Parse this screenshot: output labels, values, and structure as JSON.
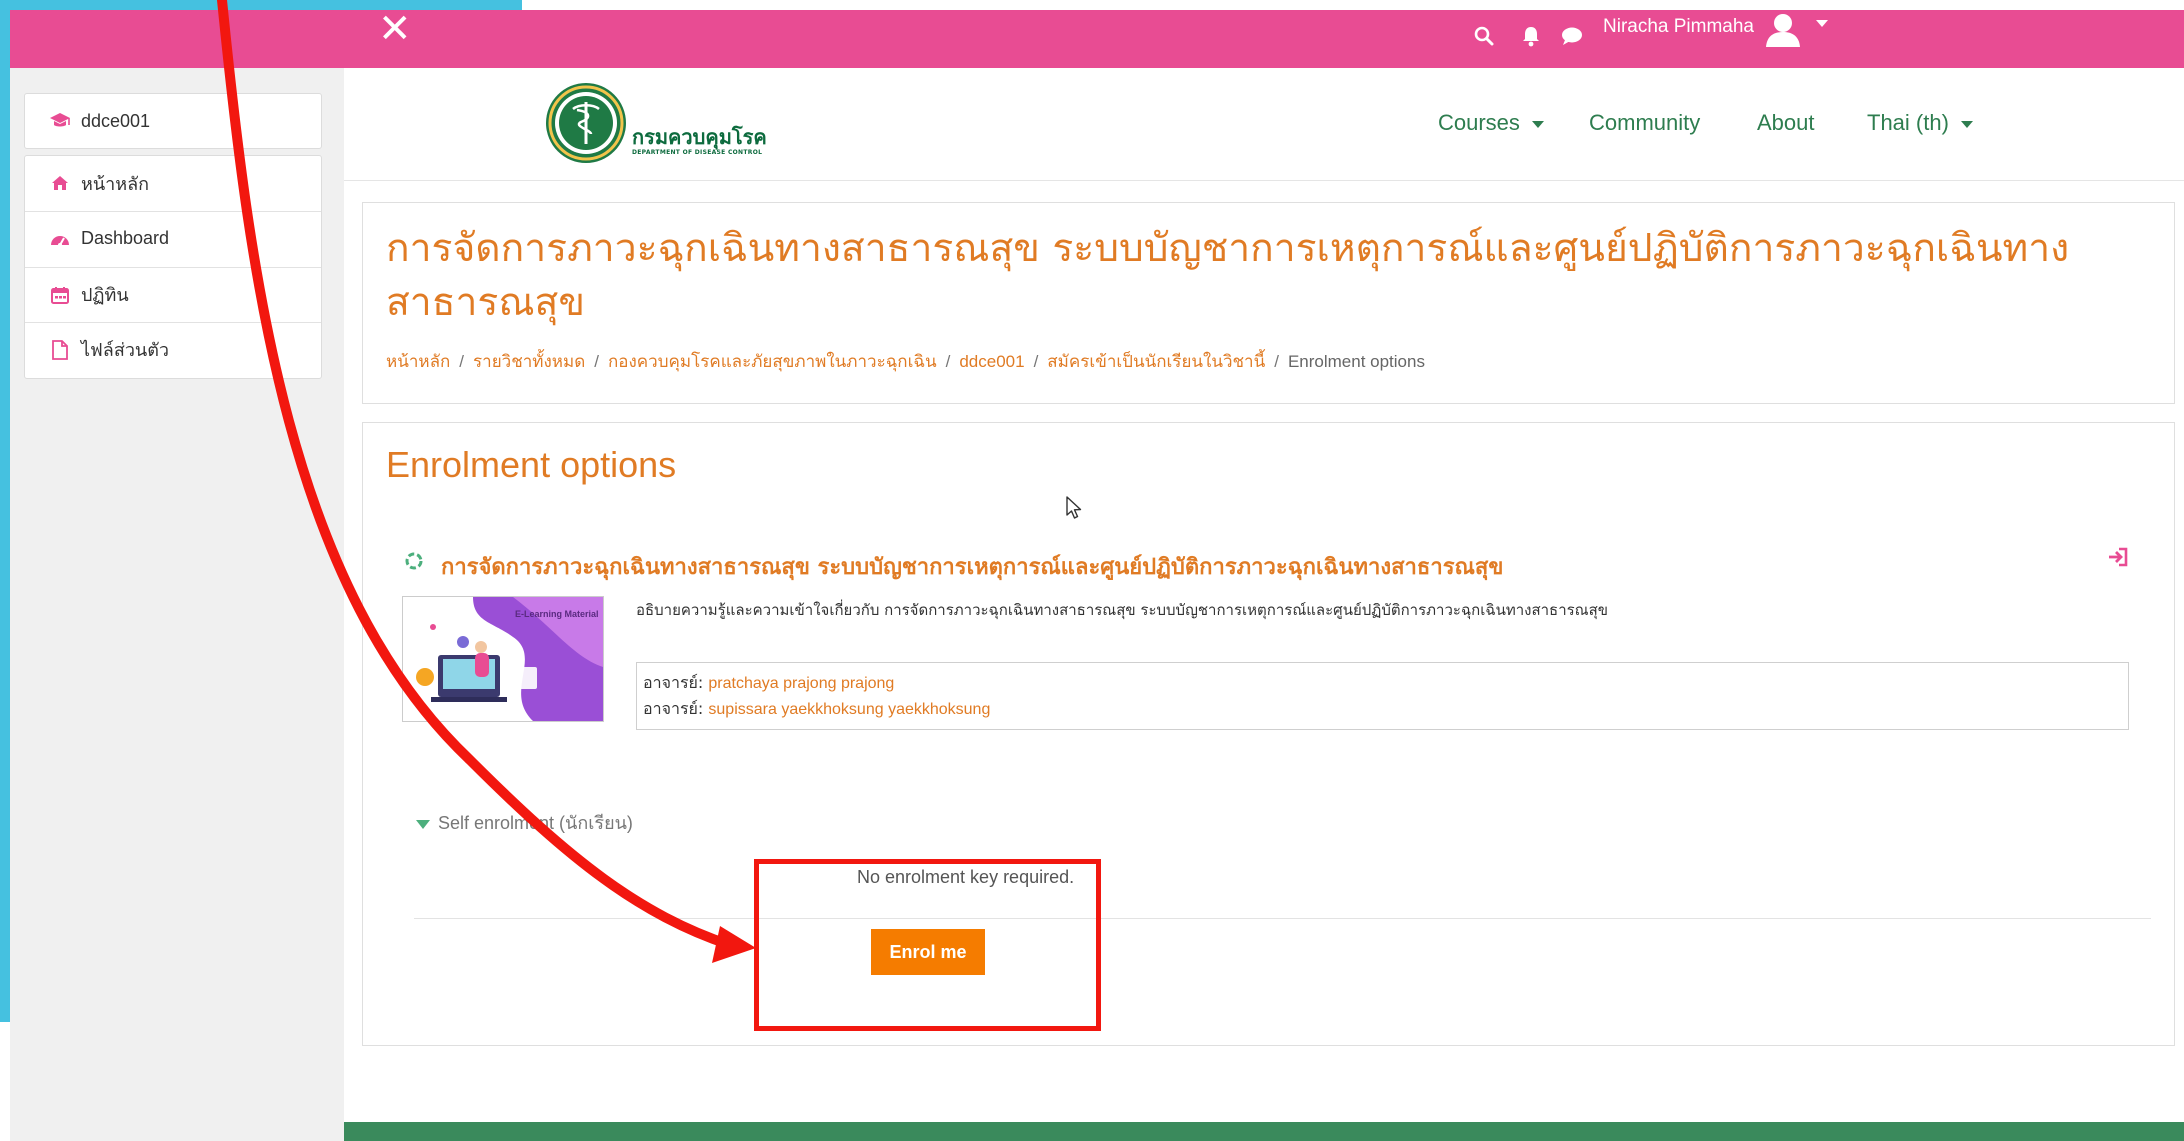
{
  "topbar": {
    "user_name": "Niracha Pimmaha"
  },
  "sidebar": {
    "course_short": "ddce001",
    "items": [
      {
        "label": "หน้าหลัก"
      },
      {
        "label": "Dashboard"
      },
      {
        "label": "ปฏิทิน"
      },
      {
        "label": "ไฟล์ส่วนตัว"
      }
    ]
  },
  "header": {
    "logo_text_th": "กรมควบคุมโรค",
    "logo_text_en": "DEPARTMENT OF DISEASE CONTROL",
    "nav": [
      {
        "label": "Courses"
      },
      {
        "label": "Community"
      },
      {
        "label": "About"
      },
      {
        "label": "Thai (th)"
      }
    ]
  },
  "page": {
    "title": "การจัดการภาวะฉุกเฉินทางสาธารณสุข ระบบบัญชาการเหตุการณ์และศูนย์ปฏิบัติการภาวะฉุกเฉินทาง สาธารณสุข",
    "breadcrumb": [
      "หน้าหลัก",
      "รายวิชาทั้งหมด",
      "กองควบคุมโรคและภัยสุขภาพในภาวะฉุกเฉิน",
      "ddce001",
      "สมัครเข้าเป็นนักเรียนในวิชานี้",
      "Enrolment options"
    ]
  },
  "enrol": {
    "heading": "Enrolment options",
    "course_name": "การจัดการภาวะฉุกเฉินทางสาธารณสุข ระบบบัญชาการเหตุการณ์และศูนย์ปฏิบัติการภาวะฉุกเฉินทางสาธารณสุข",
    "image_caption": "E-Learning Material",
    "summary": "อธิบายความรู้และความเข้าใจเกี่ยวกับ การจัดการภาวะฉุกเฉินทางสาธารณสุข ระบบบัญชาการเหตุการณ์และศูนย์ปฏิบัติการภาวะฉุกเฉินทางสาธารณสุข",
    "teacher_role": "อาจารย์: ",
    "teachers": [
      "pratchaya prajong prajong",
      "supissara yaekkhoksung yaekkhoksung"
    ],
    "self_enrol_label": "Self enrolment (นักเรียน)",
    "no_key_text": "No enrolment key required.",
    "enrol_button": "Enrol me"
  },
  "colors": {
    "topbar": "#e84c93",
    "accent_orange": "#e07b24",
    "button_orange": "#f57c00",
    "nav_green": "#2e7d4f",
    "highlight_red": "#f2170f"
  }
}
